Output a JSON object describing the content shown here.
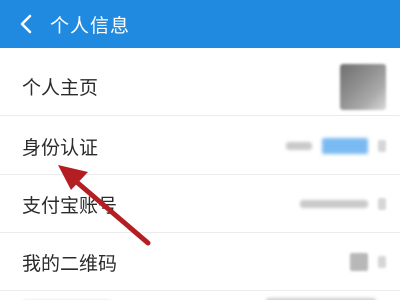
{
  "header": {
    "title": "个人信息"
  },
  "rows": [
    {
      "label": "个人主页"
    },
    {
      "label": "身份认证"
    },
    {
      "label": "支付宝账号"
    },
    {
      "label": "我的二维码"
    }
  ],
  "colors": {
    "header_bg": "#1f8ae0",
    "annotation_arrow": "#b41e22"
  }
}
